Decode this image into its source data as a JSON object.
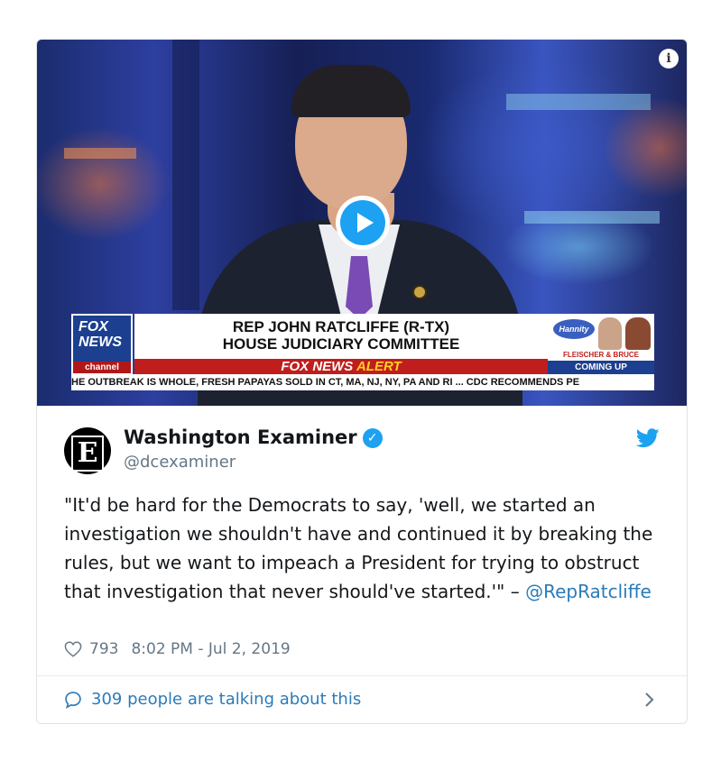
{
  "media": {
    "info_icon": "i",
    "lower_third": {
      "channel_logo_top": "FOX",
      "channel_logo_bottom": "NEWS",
      "channel_logo_tag": "channel",
      "name_line": "REP JOHN RATCLIFFE (R-TX)",
      "title_line": "HOUSE JUDICIARY COMMITTEE",
      "alert_prefix": "FOX NEWS",
      "alert_word": "ALERT",
      "promo_show": "Hannity",
      "promo_names": "FLEISCHER & BRUCE",
      "promo_status": "COMING UP",
      "ticker": "HE OUTBREAK IS WHOLE, FRESH PAPAYAS SOLD IN CT, MA, NJ, NY, PA AND RI  ...  CDC RECOMMENDS PE"
    }
  },
  "tweet": {
    "author": "Washington Examiner",
    "avatar_letter": "E",
    "verified_icon": "✓",
    "handle": "@dcexaminer",
    "text_before": "\"It'd be hard for the Democrats to say, 'well, we started an investigation we shouldn't have and continued it by breaking the rules, but we want to impeach a President for trying to obstruct that investigation that never should've started.'\" – ",
    "mention": "@RepRatcliffe",
    "likes": "793",
    "timestamp": "8:02 PM - Jul 2, 2019",
    "talking": "309 people are talking about this"
  },
  "colors": {
    "accent": "#1da1f2",
    "link": "#2b7bb9",
    "muted": "#657786"
  },
  "icons": [
    "info-icon",
    "play-icon",
    "verified-icon",
    "twitter-bird-icon",
    "heart-icon",
    "comment-bubble-icon",
    "chevron-right-icon"
  ]
}
